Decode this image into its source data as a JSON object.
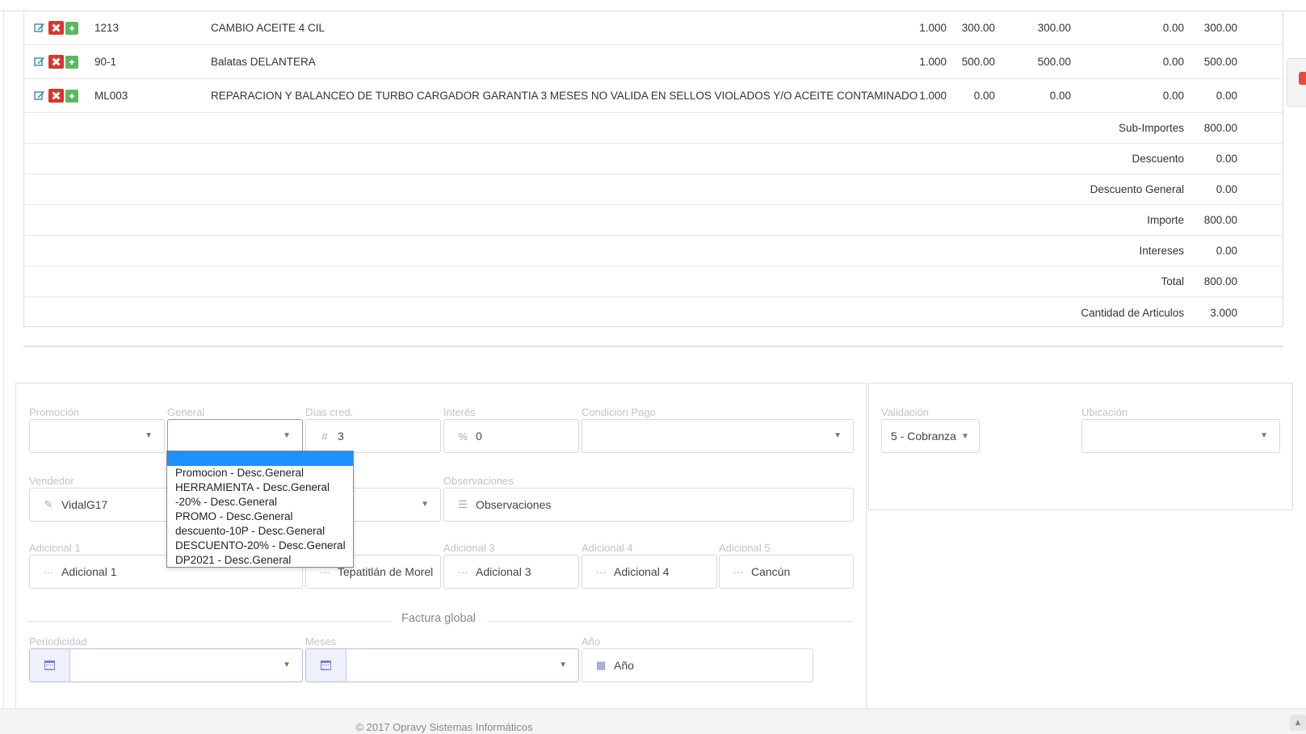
{
  "items": [
    {
      "code": "1213",
      "description": "CAMBIO ACEITE 4 CIL",
      "qty": "1.000",
      "price": "300.00",
      "subtotal": "300.00",
      "discount": "0.00",
      "total": "300.00"
    },
    {
      "code": "90-1",
      "description": "Balatas DELANTERA",
      "qty": "1.000",
      "price": "500.00",
      "subtotal": "500.00",
      "discount": "0.00",
      "total": "500.00"
    },
    {
      "code": "ML003",
      "description": "REPARACION Y BALANCEO DE TURBO CARGADOR GARANTIA 3 MESES NO VALIDA EN SELLOS VIOLADOS Y/O ACEITE CONTAMINADO",
      "qty": "1.000",
      "price": "0.00",
      "subtotal": "0.00",
      "discount": "0.00",
      "total": "0.00"
    }
  ],
  "totals": [
    {
      "label": "Sub-Importes",
      "value": "800.00"
    },
    {
      "label": "Descuento",
      "value": "0.00"
    },
    {
      "label": "Descuento General",
      "value": "0.00"
    },
    {
      "label": "Importe",
      "value": "800.00"
    },
    {
      "label": "Intereses",
      "value": "0.00"
    },
    {
      "label": "Total",
      "value": "800.00"
    },
    {
      "label": "Cantidad de Articulos",
      "value": "3.000"
    }
  ],
  "form": {
    "promocion": {
      "label": "Promoción",
      "value": ""
    },
    "general": {
      "label": "General",
      "value": ""
    },
    "dias_cred": {
      "label": "Días cred.",
      "prefix": "#",
      "value": "3"
    },
    "interes": {
      "label": "Interés",
      "prefix": "%",
      "value": "0"
    },
    "condicion_pago": {
      "label": "Condicion Pago",
      "value": ""
    },
    "vendedor": {
      "label": "Vendedor",
      "value": "VidalG17"
    },
    "observaciones": {
      "label": "Observaciones",
      "placeholder": "Observaciones"
    },
    "adicional1": {
      "label": "Adicional 1",
      "placeholder": "Adicional 1"
    },
    "adicional2": {
      "value": "Tepatitlán de Morel"
    },
    "adicional3": {
      "label": "Adicional 3",
      "placeholder": "Adicional 3"
    },
    "adicional4": {
      "label": "Adicional 4",
      "placeholder": "Adicional 4"
    },
    "adicional5": {
      "label": "Adicional 5",
      "value": "Cancún"
    },
    "factura_global": "Factura global",
    "periodicidad": {
      "label": "Periodicidad",
      "value": ""
    },
    "meses": {
      "label": "Meses",
      "value": ""
    },
    "anio": {
      "label": "Año",
      "placeholder": "Año"
    }
  },
  "side": {
    "validacion": {
      "label": "Validación",
      "value": "5 - Cobranza"
    },
    "ubicacion": {
      "label": "Ubicación",
      "value": ""
    }
  },
  "general_dropdown": {
    "options": [
      "",
      "Promocion - Desc.General",
      "HERRAMIENTA - Desc.General",
      "-20% - Desc.General",
      "PROMO - Desc.General",
      "descuento-10P - Desc.General",
      "DESCUENTO-20% - Desc.General",
      "DP2021 - Desc.General"
    ],
    "highlighted_index": 0
  },
  "footer": "© 2017 Opravy Sistemas Informáticos",
  "icons": {
    "edit": "edit-icon",
    "delete": "delete-icon",
    "add": "add-icon",
    "hash": "hash-icon",
    "percent": "percent-icon",
    "ellipsis": "ellipsis-icon",
    "list": "list-icon",
    "calendar": "calendar-icon",
    "caret": "caret-down-icon"
  },
  "colors": {
    "delete": "#d9352e",
    "add": "#5cb85c",
    "edit": "#3a87ad",
    "highlight": "#1e90ff"
  }
}
